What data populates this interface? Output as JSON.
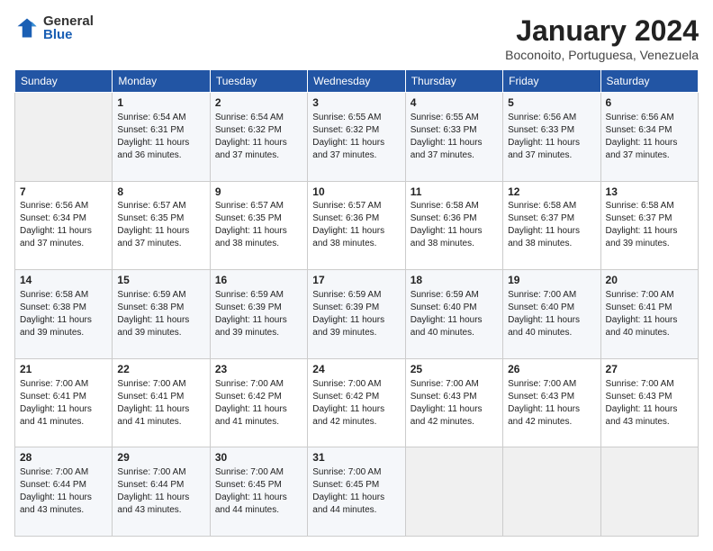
{
  "header": {
    "logo_general": "General",
    "logo_blue": "Blue",
    "title": "January 2024",
    "location": "Boconoito, Portuguesa, Venezuela"
  },
  "days_of_week": [
    "Sunday",
    "Monday",
    "Tuesday",
    "Wednesday",
    "Thursday",
    "Friday",
    "Saturday"
  ],
  "weeks": [
    [
      {
        "day": "",
        "content": ""
      },
      {
        "day": "1",
        "content": "Sunrise: 6:54 AM\nSunset: 6:31 PM\nDaylight: 11 hours\nand 36 minutes."
      },
      {
        "day": "2",
        "content": "Sunrise: 6:54 AM\nSunset: 6:32 PM\nDaylight: 11 hours\nand 37 minutes."
      },
      {
        "day": "3",
        "content": "Sunrise: 6:55 AM\nSunset: 6:32 PM\nDaylight: 11 hours\nand 37 minutes."
      },
      {
        "day": "4",
        "content": "Sunrise: 6:55 AM\nSunset: 6:33 PM\nDaylight: 11 hours\nand 37 minutes."
      },
      {
        "day": "5",
        "content": "Sunrise: 6:56 AM\nSunset: 6:33 PM\nDaylight: 11 hours\nand 37 minutes."
      },
      {
        "day": "6",
        "content": "Sunrise: 6:56 AM\nSunset: 6:34 PM\nDaylight: 11 hours\nand 37 minutes."
      }
    ],
    [
      {
        "day": "7",
        "content": "Sunrise: 6:56 AM\nSunset: 6:34 PM\nDaylight: 11 hours\nand 37 minutes."
      },
      {
        "day": "8",
        "content": "Sunrise: 6:57 AM\nSunset: 6:35 PM\nDaylight: 11 hours\nand 37 minutes."
      },
      {
        "day": "9",
        "content": "Sunrise: 6:57 AM\nSunset: 6:35 PM\nDaylight: 11 hours\nand 38 minutes."
      },
      {
        "day": "10",
        "content": "Sunrise: 6:57 AM\nSunset: 6:36 PM\nDaylight: 11 hours\nand 38 minutes."
      },
      {
        "day": "11",
        "content": "Sunrise: 6:58 AM\nSunset: 6:36 PM\nDaylight: 11 hours\nand 38 minutes."
      },
      {
        "day": "12",
        "content": "Sunrise: 6:58 AM\nSunset: 6:37 PM\nDaylight: 11 hours\nand 38 minutes."
      },
      {
        "day": "13",
        "content": "Sunrise: 6:58 AM\nSunset: 6:37 PM\nDaylight: 11 hours\nand 39 minutes."
      }
    ],
    [
      {
        "day": "14",
        "content": "Sunrise: 6:58 AM\nSunset: 6:38 PM\nDaylight: 11 hours\nand 39 minutes."
      },
      {
        "day": "15",
        "content": "Sunrise: 6:59 AM\nSunset: 6:38 PM\nDaylight: 11 hours\nand 39 minutes."
      },
      {
        "day": "16",
        "content": "Sunrise: 6:59 AM\nSunset: 6:39 PM\nDaylight: 11 hours\nand 39 minutes."
      },
      {
        "day": "17",
        "content": "Sunrise: 6:59 AM\nSunset: 6:39 PM\nDaylight: 11 hours\nand 39 minutes."
      },
      {
        "day": "18",
        "content": "Sunrise: 6:59 AM\nSunset: 6:40 PM\nDaylight: 11 hours\nand 40 minutes."
      },
      {
        "day": "19",
        "content": "Sunrise: 7:00 AM\nSunset: 6:40 PM\nDaylight: 11 hours\nand 40 minutes."
      },
      {
        "day": "20",
        "content": "Sunrise: 7:00 AM\nSunset: 6:41 PM\nDaylight: 11 hours\nand 40 minutes."
      }
    ],
    [
      {
        "day": "21",
        "content": "Sunrise: 7:00 AM\nSunset: 6:41 PM\nDaylight: 11 hours\nand 41 minutes."
      },
      {
        "day": "22",
        "content": "Sunrise: 7:00 AM\nSunset: 6:41 PM\nDaylight: 11 hours\nand 41 minutes."
      },
      {
        "day": "23",
        "content": "Sunrise: 7:00 AM\nSunset: 6:42 PM\nDaylight: 11 hours\nand 41 minutes."
      },
      {
        "day": "24",
        "content": "Sunrise: 7:00 AM\nSunset: 6:42 PM\nDaylight: 11 hours\nand 42 minutes."
      },
      {
        "day": "25",
        "content": "Sunrise: 7:00 AM\nSunset: 6:43 PM\nDaylight: 11 hours\nand 42 minutes."
      },
      {
        "day": "26",
        "content": "Sunrise: 7:00 AM\nSunset: 6:43 PM\nDaylight: 11 hours\nand 42 minutes."
      },
      {
        "day": "27",
        "content": "Sunrise: 7:00 AM\nSunset: 6:43 PM\nDaylight: 11 hours\nand 43 minutes."
      }
    ],
    [
      {
        "day": "28",
        "content": "Sunrise: 7:00 AM\nSunset: 6:44 PM\nDaylight: 11 hours\nand 43 minutes."
      },
      {
        "day": "29",
        "content": "Sunrise: 7:00 AM\nSunset: 6:44 PM\nDaylight: 11 hours\nand 43 minutes."
      },
      {
        "day": "30",
        "content": "Sunrise: 7:00 AM\nSunset: 6:45 PM\nDaylight: 11 hours\nand 44 minutes."
      },
      {
        "day": "31",
        "content": "Sunrise: 7:00 AM\nSunset: 6:45 PM\nDaylight: 11 hours\nand 44 minutes."
      },
      {
        "day": "",
        "content": ""
      },
      {
        "day": "",
        "content": ""
      },
      {
        "day": "",
        "content": ""
      }
    ]
  ]
}
